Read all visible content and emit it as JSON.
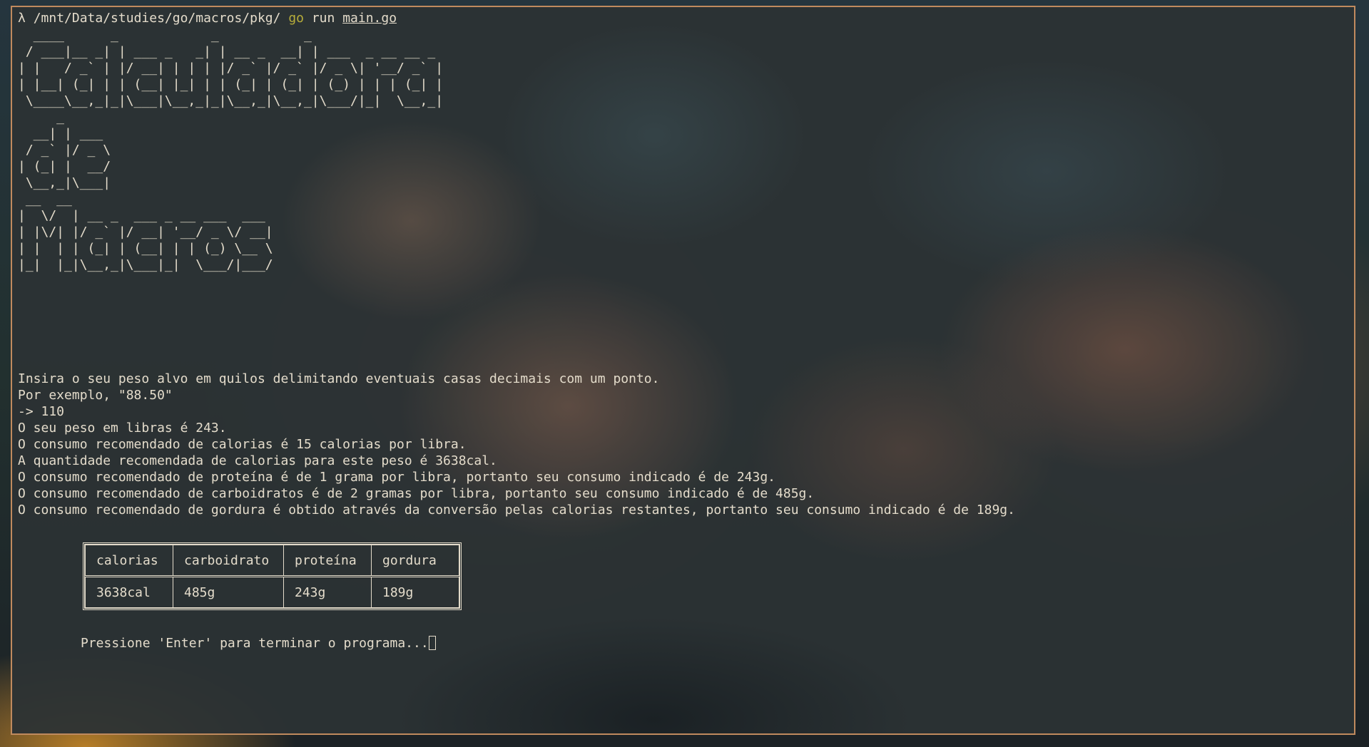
{
  "terminal": {
    "prompt": {
      "lambda": "λ",
      "cwd": "/mnt/Data/studies/go/macros/pkg/",
      "command": "go",
      "args": "run",
      "file": "main.go"
    },
    "banner": "  ____      _            _           _                 \n / ___|__ _| | ___ _   _| | __ _  __| | ___  _ __ __ _ \n| |   / _` | |/ __| | | | |/ _` |/ _` |/ _ \\| '__/ _` |\n| |__| (_| | | (__| |_| | | (_| | (_| | (_) | | | (_| |\n \\____\\__,_|_|\\___|\\__,_|_|\\__,_|\\__,_|\\___/|_|  \\__,_|\n     _      \n  __| | ___ \n / _` |/ _ \\\n| (_| |  __/\n \\__,_|\\___|\n __  __                          \n|  \\/  | __ _  ___ _ __ ___  ___ \n| |\\/| |/ _` |/ __| '__/ _ \\/ __|\n| |  | | (_| | (__| | | (_) \\__ \\\n|_|  |_|\\__,_|\\___|_|  \\___/|___/",
    "output_lines": [
      "Insira o seu peso alvo em quilos delimitando eventuais casas decimais com um ponto.",
      "Por exemplo, \"88.50\"",
      "-> 110",
      "O seu peso em libras é 243.",
      "O consumo recomendado de calorias é 15 calorias por libra.",
      "A quantidade recomendada de calorias para este peso é 3638cal.",
      "O consumo recomendado de proteína é de 1 grama por libra, portanto seu consumo indicado é de 243g.",
      "O consumo recomendado de carboidratos é de 2 gramas por libra, portanto seu consumo indicado é de 485g.",
      "O consumo recomendado de gordura é obtido através da conversão pelas calorias restantes, portanto seu consumo indicado é de 189g."
    ],
    "table": {
      "headers": [
        "calorias",
        "carboidrato",
        "proteína",
        "gordura"
      ],
      "rows": [
        [
          "3638cal",
          "485g",
          "243g",
          "189g"
        ]
      ]
    },
    "exit_prompt": "Pressione 'Enter' para terminar o programa...",
    "colors": {
      "text": "#e4dccb",
      "go_keyword": "#b7ad3a",
      "window_border": "#c08a5e"
    }
  }
}
